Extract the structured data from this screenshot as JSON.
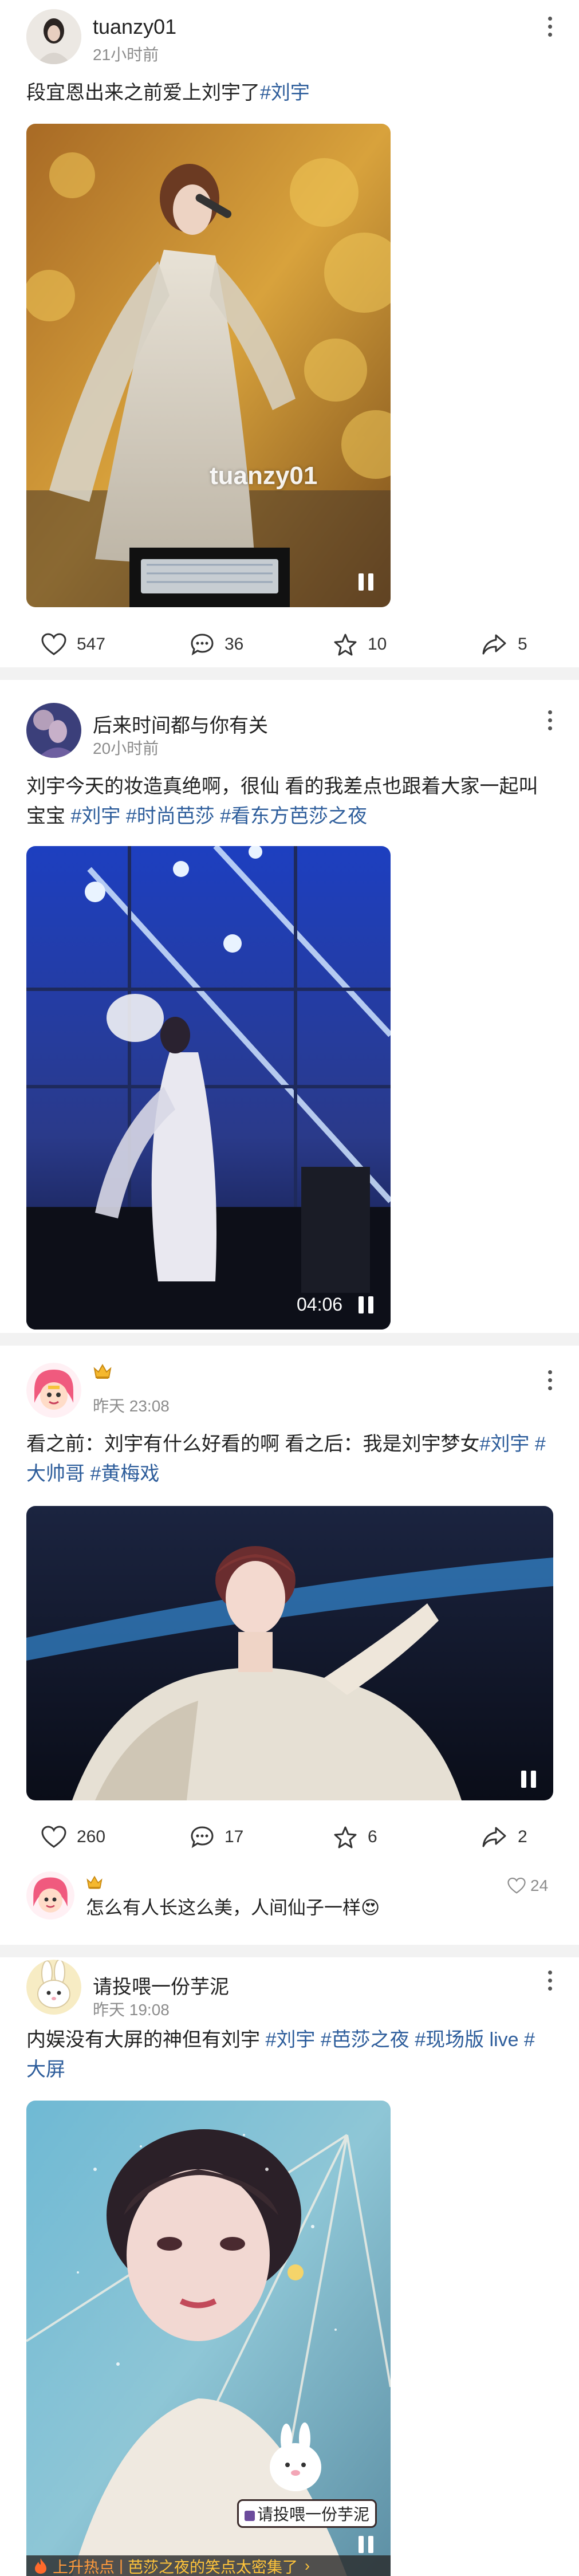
{
  "posts": [
    {
      "author": "tuanzy01",
      "time": "21小时前",
      "text": "段宜恩出来之前爱上刘宇了",
      "tags": [
        "#刘宇"
      ],
      "watermark": "tuanzy01",
      "actions": {
        "likes": "547",
        "comments": "36",
        "favorites": "10",
        "shares": "5"
      }
    },
    {
      "author": "后来时间都与你有关",
      "time": "20小时前",
      "text": "刘宇今天的妆造真绝啊，很仙 看的我差点也跟着大家一起叫宝宝",
      "tags": [
        "#刘宇",
        "#时尚芭莎",
        "#看东方芭莎之夜"
      ],
      "duration": "04:06"
    },
    {
      "author": "",
      "time": "昨天 23:08",
      "text": "看之前：刘宇有什么好看的啊 看之后：我是刘宇梦女",
      "tags": [
        "#刘宇",
        "#大帅哥",
        "#黄梅戏"
      ],
      "actions": {
        "likes": "260",
        "comments": "17",
        "favorites": "6",
        "shares": "2"
      },
      "comment": {
        "text": "怎么有人长这么美，人间仙子一样",
        "emoji": "😍",
        "likes": "24"
      }
    },
    {
      "author": "请投喂一份芋泥",
      "time": "昨天 19:08",
      "text": "内娱没有大屏的神但有刘宇",
      "tags": [
        "#刘宇",
        "#芭莎之夜",
        "#现场版 live",
        "#大屏"
      ],
      "sticker": "请投喂一份芋泥",
      "hot_prefix": "上升热点",
      "hot_text": "芭莎之夜的笑点太密集了"
    }
  ],
  "colors": {
    "tag": "#2d5d9b",
    "time": "#8c8c8c",
    "separator": "#f2f2f2"
  }
}
